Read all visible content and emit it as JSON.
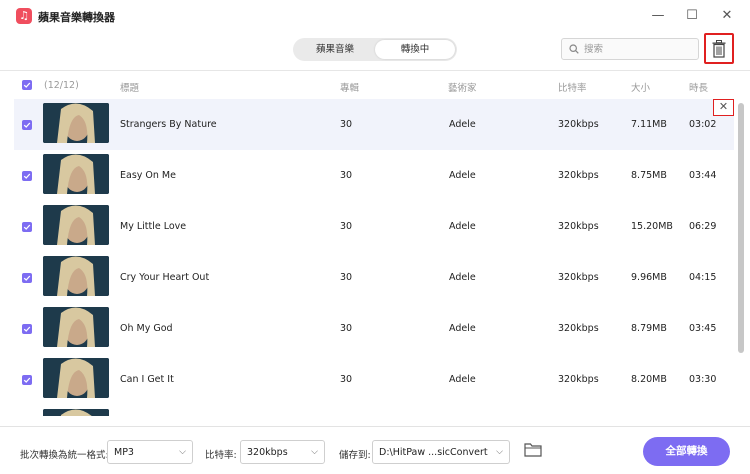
{
  "app": {
    "title": "蘋果音樂轉換器",
    "logo_icon": "music-note-icon",
    "accent": "#7d6cf2",
    "highlight_red": "#e02020"
  },
  "window": {
    "minimize": "—",
    "maximize": "☐",
    "close": "✕"
  },
  "tabs": [
    {
      "label": "蘋果音樂",
      "active": false
    },
    {
      "label": "轉換中",
      "active": true
    }
  ],
  "search": {
    "placeholder": "搜索",
    "value": ""
  },
  "columns": {
    "count": "(12/12)",
    "title": "標題",
    "album": "專輯",
    "artist": "藝術家",
    "bitrate": "比特率",
    "size": "大小",
    "duration": "時長"
  },
  "tracks": [
    {
      "title": "Strangers By Nature",
      "album": "30",
      "artist": "Adele",
      "bitrate": "320kbps",
      "size": "7.11MB",
      "duration": "03:02",
      "checked": true,
      "highlighted": true
    },
    {
      "title": "Easy On Me",
      "album": "30",
      "artist": "Adele",
      "bitrate": "320kbps",
      "size": "8.75MB",
      "duration": "03:44",
      "checked": true
    },
    {
      "title": "My Little Love",
      "album": "30",
      "artist": "Adele",
      "bitrate": "320kbps",
      "size": "15.20MB",
      "duration": "06:29",
      "checked": true
    },
    {
      "title": "Cry Your Heart Out",
      "album": "30",
      "artist": "Adele",
      "bitrate": "320kbps",
      "size": "9.96MB",
      "duration": "04:15",
      "checked": true
    },
    {
      "title": "Oh My God",
      "album": "30",
      "artist": "Adele",
      "bitrate": "320kbps",
      "size": "8.79MB",
      "duration": "03:45",
      "checked": true
    },
    {
      "title": "Can I Get It",
      "album": "30",
      "artist": "Adele",
      "bitrate": "320kbps",
      "size": "8.20MB",
      "duration": "03:30",
      "checked": true
    }
  ],
  "row_remove_icon": "✕",
  "footer": {
    "format_label": "批次轉換為統一格式:",
    "format_value": "MP3",
    "bitrate_label": "比特率:",
    "bitrate_value": "320kbps",
    "save_label": "儲存到:",
    "save_value": "D:\\HitPaw ...sicConvert",
    "convert_all": "全部轉換"
  }
}
